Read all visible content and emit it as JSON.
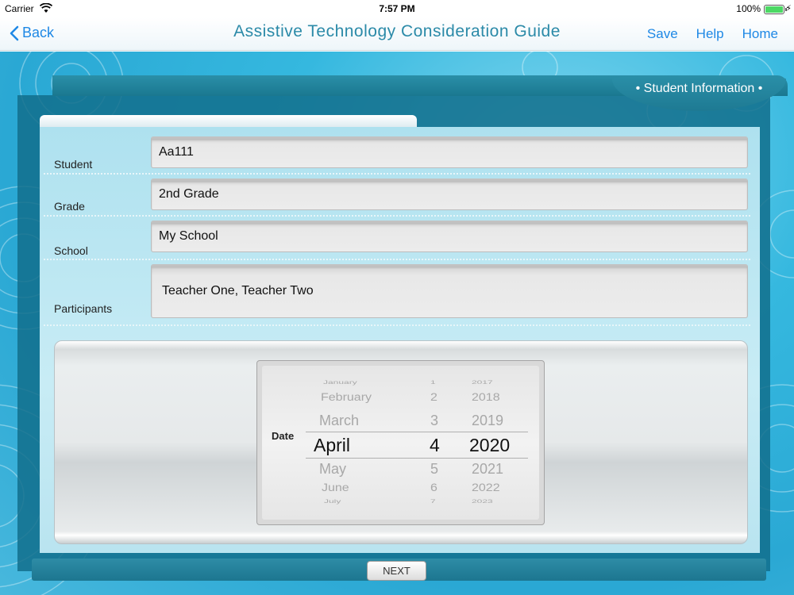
{
  "status_bar": {
    "carrier": "Carrier",
    "time": "7:57 PM",
    "battery": "100%"
  },
  "nav": {
    "back_label": "Back",
    "title": "Assistive Technology Consideration Guide",
    "save_label": "Save",
    "help_label": "Help",
    "home_label": "Home",
    "accent_color": "#1e88e5"
  },
  "section_title": "• Student Information •",
  "form": {
    "student_label": "Student",
    "student_value": "Aa111",
    "grade_label": "Grade",
    "grade_value": "2nd Grade",
    "school_label": "School",
    "school_value": "My School",
    "participants_label": "Participants",
    "participants_value": "Teacher One, Teacher Two"
  },
  "date_picker": {
    "label": "Date",
    "months": [
      "January",
      "February",
      "March",
      "April",
      "May",
      "June",
      "July"
    ],
    "days": [
      "1",
      "2",
      "3",
      "4",
      "5",
      "6",
      "7"
    ],
    "years": [
      "2017",
      "2018",
      "2019",
      "2020",
      "2021",
      "2022",
      "2023"
    ],
    "selected_index": 3
  },
  "footer": {
    "next_label": "NEXT"
  }
}
